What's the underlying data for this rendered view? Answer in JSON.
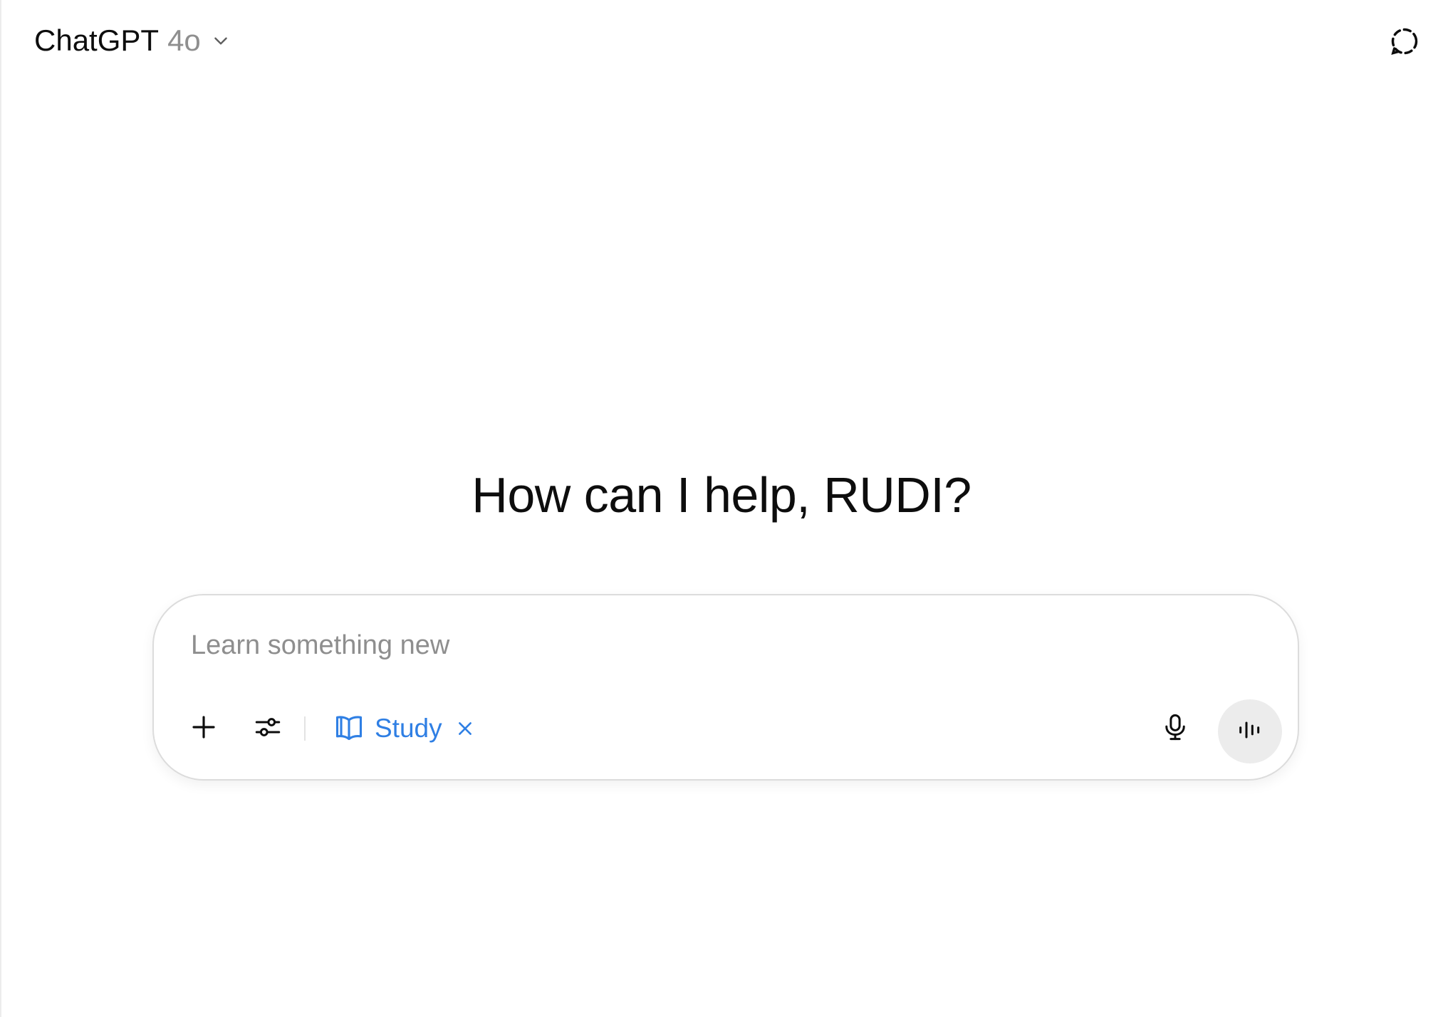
{
  "header": {
    "brand": "ChatGPT",
    "model_version": "4o",
    "model_menu_icon": "chevron-down-icon",
    "temporary_chat_icon": "dashed-chat-bubble-icon"
  },
  "main": {
    "greeting": "How can I help, RUDI?"
  },
  "composer": {
    "placeholder": "Learn something new",
    "value": "",
    "add_icon": "plus-icon",
    "tools_icon": "sliders-icon",
    "active_tool": {
      "label": "Study",
      "icon": "open-book-icon",
      "close_icon": "close-icon",
      "color": "#2f7fe4"
    },
    "dictate_icon": "microphone-icon",
    "voice_mode_icon": "sound-wave-icon"
  }
}
